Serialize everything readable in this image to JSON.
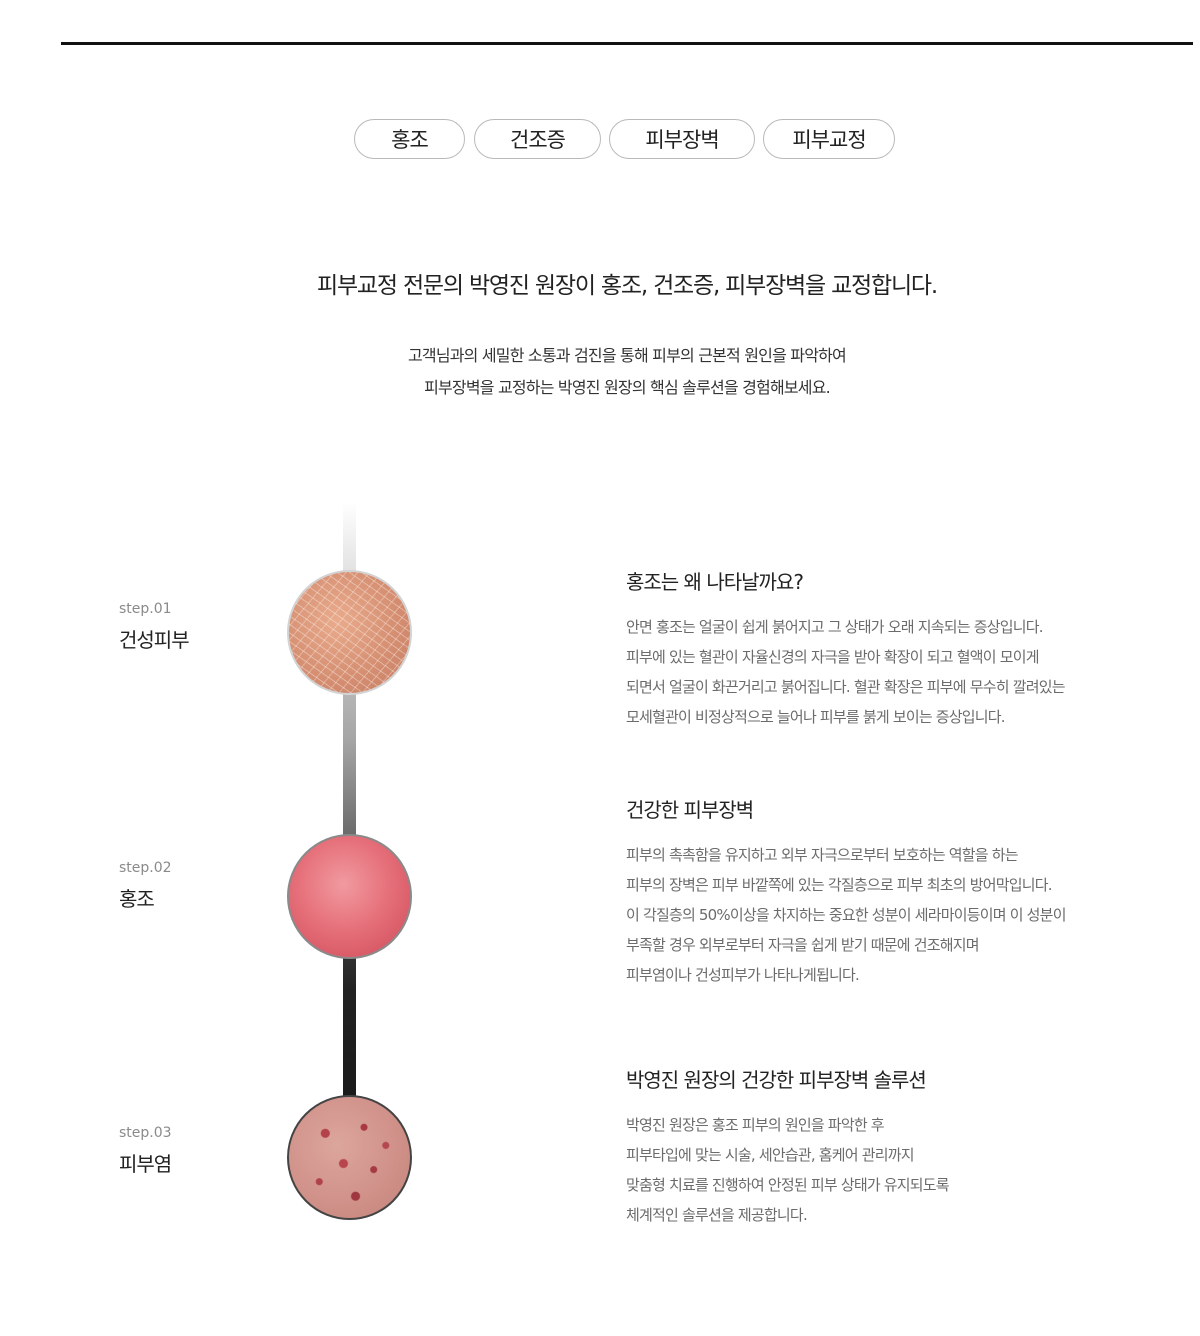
{
  "tabs": [
    "홍조",
    "건조증",
    "피부장벽",
    "피부교정"
  ],
  "headline": "피부교정 전문의 박영진 원장이 홍조, 건조증, 피부장벽을 교정합니다.",
  "intro": [
    "고객님과의 세밀한 소통과 검진을 통해 피부의 근본적 원인을 파악하여",
    "피부장벽을 교정하는 박영진 원장의 핵심 솔루션을 경험해보세요."
  ],
  "steps": [
    {
      "label": "step.01",
      "name": "건성피부",
      "image": "dry-skin-photo"
    },
    {
      "label": "step.02",
      "name": "홍조",
      "image": "redness-skin-photo"
    },
    {
      "label": "step.03",
      "name": "피부염",
      "image": "dermatitis-skin-photo"
    }
  ],
  "sections": [
    {
      "title": "홍조는 왜 나타날까요?",
      "lines": [
        "안면 홍조는 얼굴이 쉽게 붉어지고 그 상태가 오래 지속되는 증상입니다.",
        "피부에 있는 혈관이 자율신경의 자극을 받아 확장이 되고 혈액이 모이게",
        "되면서 얼굴이 화끈거리고 붉어집니다. 혈관 확장은 피부에 무수히 깔려있는",
        "모세혈관이 비정상적으로 늘어나 피부를 붉게 보이는 증상입니다."
      ]
    },
    {
      "title": "건강한 피부장벽",
      "lines": [
        "피부의 촉촉함을 유지하고 외부 자극으로부터 보호하는 역할을 하는",
        "피부의 장벽은 피부 바깥쪽에 있는 각질층으로 피부 최초의 방어막입니다.",
        "이 각질층의 50%이상을 차지하는 중요한 성분이 세라마이등이며 이 성분이",
        "부족할 경우 외부로부터 자극을 쉽게 받기 때문에 건조해지며",
        "피부염이나 건성피부가 나타나게됩니다."
      ]
    },
    {
      "title": "박영진 원장의 건강한 피부장벽 솔루션",
      "lines": [
        "박영진 원장은 홍조 피부의 원인을 파악한 후",
        "피부타입에 맞는 시술, 세안습관, 홈케어 관리까지",
        "맞춤형 치료를 진행하여 안정된 피부 상태가 유지되도록",
        "체계적인 솔루션을 제공합니다."
      ]
    }
  ]
}
